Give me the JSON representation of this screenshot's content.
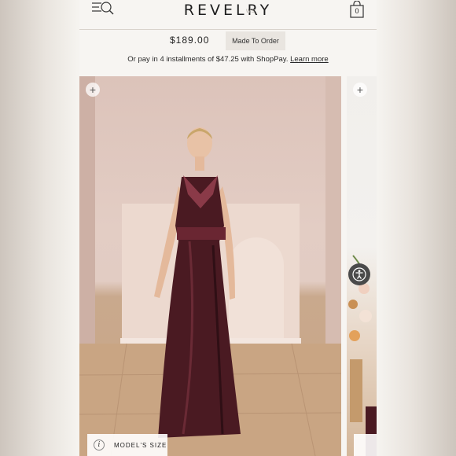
{
  "header": {
    "logo": "REVELRY",
    "ghost_text": "ws",
    "bag_count": "0",
    "menu_icon": "menu-search-icon",
    "bag_icon": "shopping-bag-icon"
  },
  "product": {
    "price": "$189.00",
    "availability": "Made To Order",
    "installments_text": "Or pay in 4 installments of $47.25 with ShopPay.",
    "learn_more": "Learn more"
  },
  "gallery": {
    "zoom_icon": "plus-icon",
    "models_size_label": "MODEL'S SIZE",
    "info_icon": "i",
    "dress_color": "#4a1a22"
  },
  "accessibility": {
    "icon": "accessibility-icon"
  }
}
